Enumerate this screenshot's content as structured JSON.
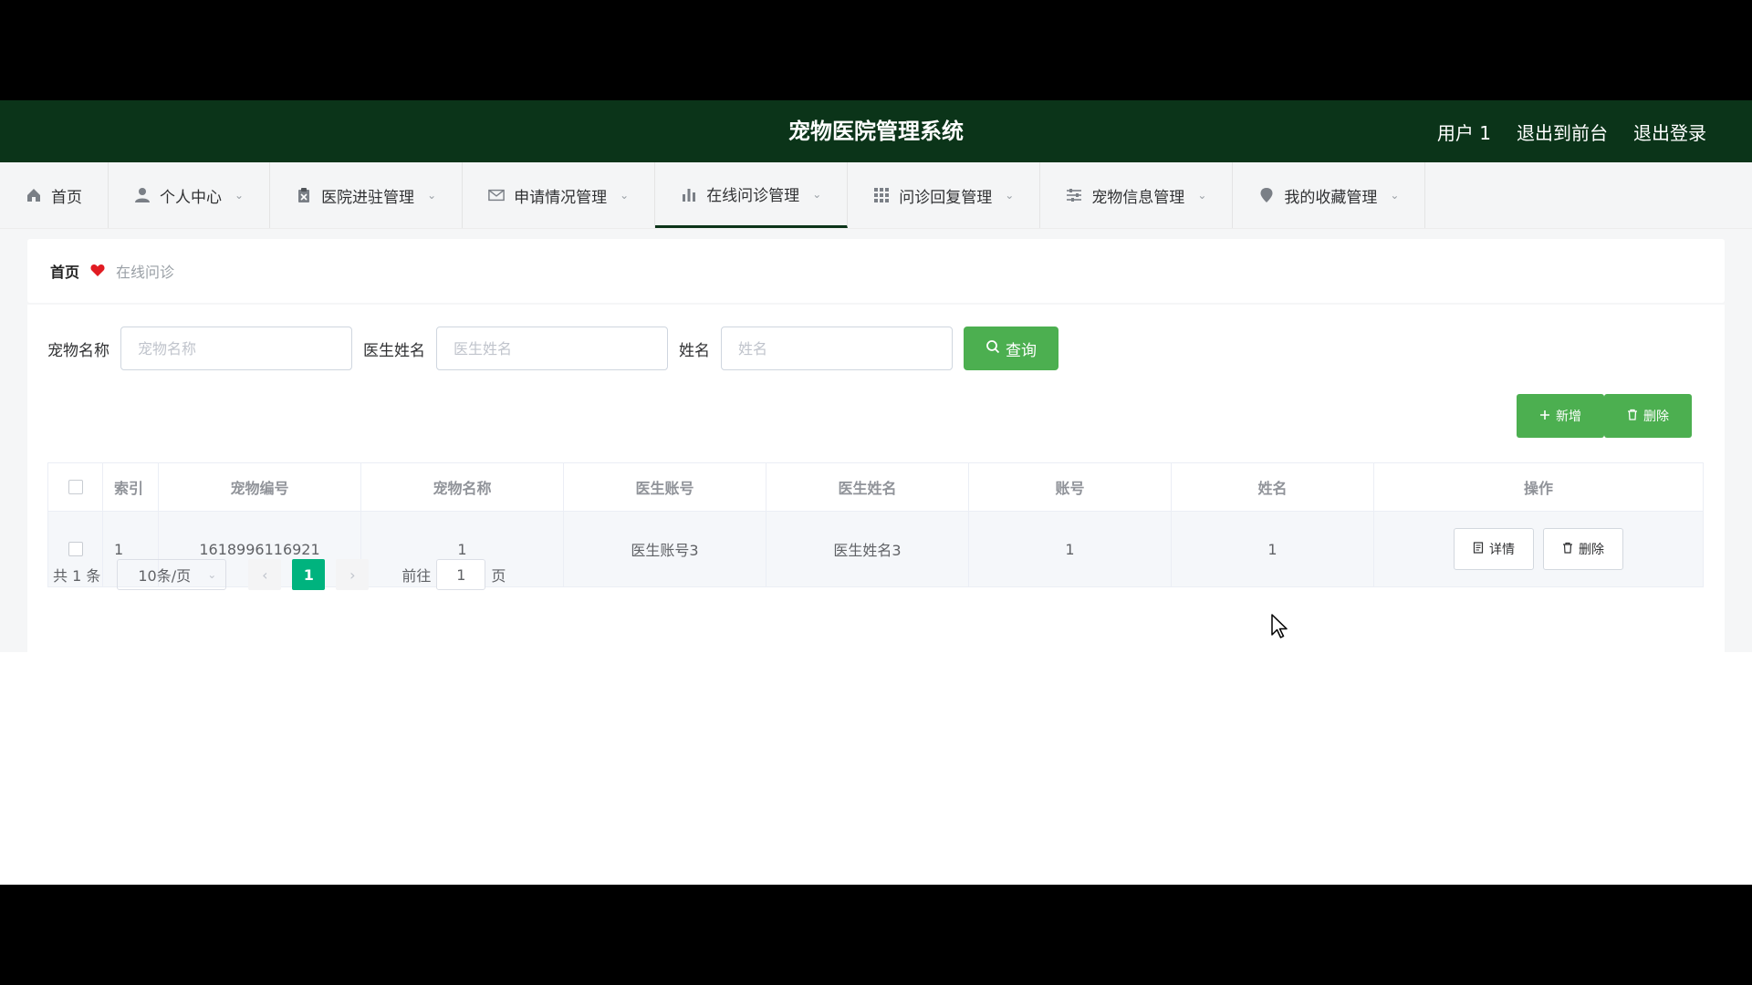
{
  "header": {
    "title": "宠物医院管理系统",
    "user": "用户 1",
    "back_to_front": "退出到前台",
    "logout": "退出登录"
  },
  "nav": [
    {
      "label": "首页",
      "icon": "home-icon"
    },
    {
      "label": "个人中心",
      "icon": "user-icon"
    },
    {
      "label": "医院进驻管理",
      "icon": "clipboard-icon"
    },
    {
      "label": "申请情况管理",
      "icon": "mail-icon"
    },
    {
      "label": "在线问诊管理",
      "icon": "bar-chart-icon",
      "active": true
    },
    {
      "label": "问诊回复管理",
      "icon": "grid-icon"
    },
    {
      "label": "宠物信息管理",
      "icon": "sliders-icon"
    },
    {
      "label": "我的收藏管理",
      "icon": "location-icon"
    }
  ],
  "breadcrumb": {
    "home": "首页",
    "current": "在线问诊"
  },
  "filters": {
    "pet_name_label": "宠物名称",
    "pet_name_placeholder": "宠物名称",
    "doctor_name_label": "医生姓名",
    "doctor_name_placeholder": "医生姓名",
    "name_label": "姓名",
    "name_placeholder": "姓名",
    "query_label": "查询"
  },
  "actions": {
    "add_label": "新增",
    "delete_label": "删除"
  },
  "table": {
    "headers": [
      "索引",
      "宠物编号",
      "宠物名称",
      "医生账号",
      "医生姓名",
      "账号",
      "姓名",
      "操作"
    ],
    "rows": [
      {
        "index": "1",
        "pet_no": "1618996116921",
        "pet_name": "1",
        "doctor_account": "医生账号3",
        "doctor_name": "医生姓名3",
        "account": "1",
        "name": "1",
        "detail_label": "详情",
        "delete_label": "删除"
      }
    ]
  },
  "pagination": {
    "total": "共 1 条",
    "page_size": "10条/页",
    "current_page": "1",
    "goto_prefix": "前往",
    "goto_value": "1",
    "goto_suffix": "页"
  },
  "colors": {
    "header_bg": "#0b3419",
    "primary_green": "#4caf50",
    "page_active": "#00b37e"
  }
}
